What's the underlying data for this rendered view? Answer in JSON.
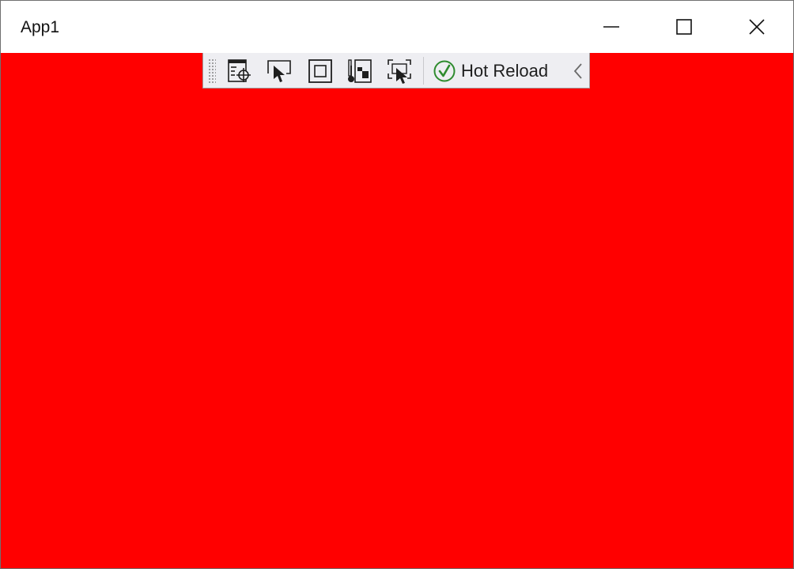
{
  "window": {
    "title": "App1",
    "content_background": "#ff0000"
  },
  "caption_buttons": {
    "minimize_icon": "minimize-icon",
    "maximize_icon": "maximize-icon",
    "close_icon": "close-icon"
  },
  "toolbar": {
    "background": "#eeeef2",
    "buttons": [
      {
        "name": "go-to-live-visual-tree",
        "icon": "live-visual-tree-icon"
      },
      {
        "name": "select-element",
        "icon": "select-element-cursor-icon"
      },
      {
        "name": "display-layout-adorners",
        "icon": "layout-adorner-icon"
      },
      {
        "name": "track-focus",
        "icon": "thermometer-icon"
      },
      {
        "name": "preview-selection",
        "icon": "preview-selection-icon"
      }
    ],
    "hot_reload": {
      "label": "Hot Reload",
      "status_icon": "checkmark-circle-icon",
      "status_color": "#2e8b2e"
    },
    "collapse_icon": "chevron-left-icon"
  }
}
